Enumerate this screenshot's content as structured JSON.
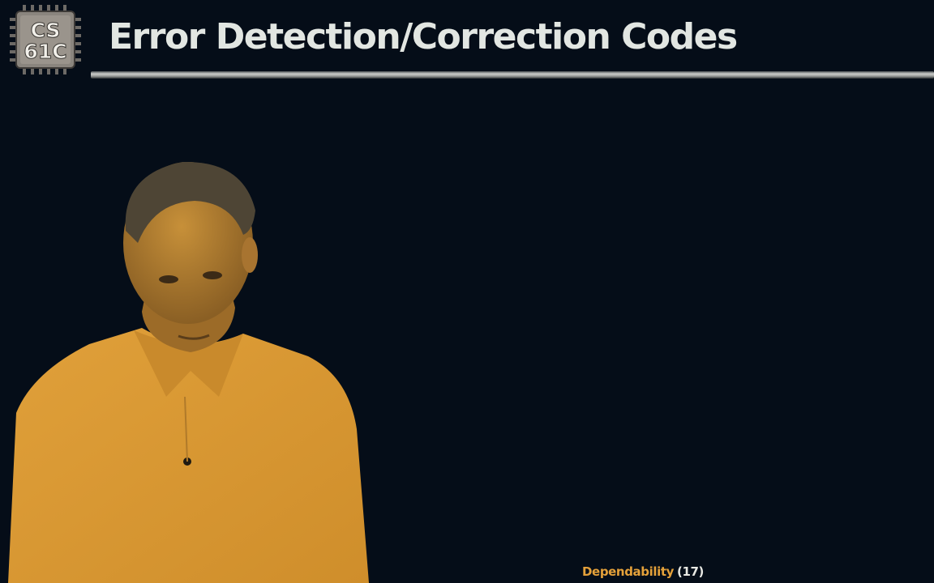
{
  "slide": {
    "title": "Error Detection/Correction Codes",
    "logo": {
      "line1": "CS",
      "line2": "61C"
    },
    "footer": {
      "section": "Dependability",
      "page": "(17)"
    }
  },
  "colors": {
    "background": "#050d18",
    "title_text": "#e2e6e2",
    "footer_accent": "#e5a13a",
    "presenter_tint": "#d9982e"
  }
}
